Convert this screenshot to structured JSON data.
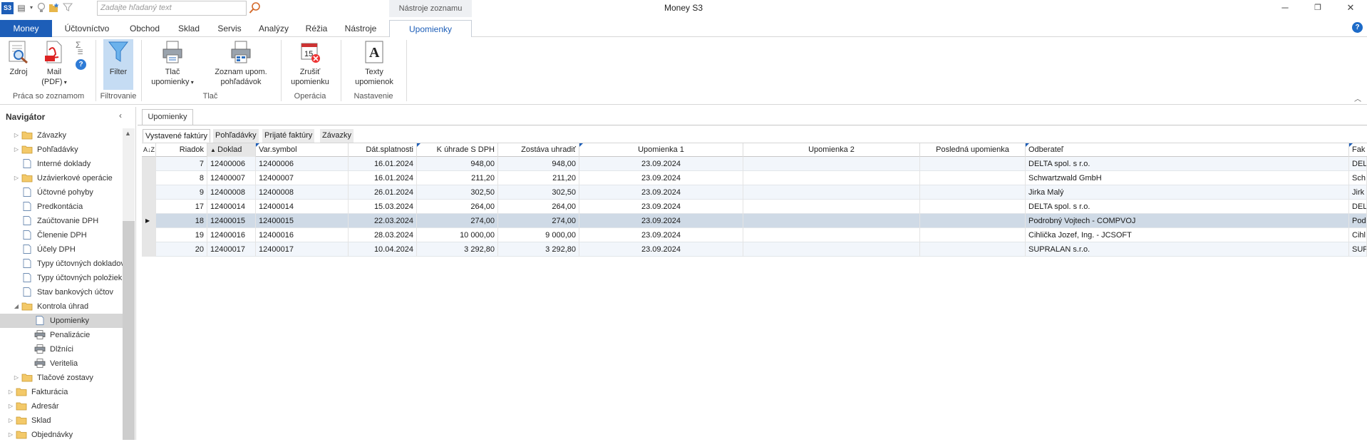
{
  "app": {
    "title": "Money S3",
    "logo": "S3",
    "search_placeholder": "Zadajte hľadaný text",
    "context_tab_title": "Nástroje zoznamu"
  },
  "ribbon_tabs": [
    "Money",
    "Účtovníctvo",
    "Obchod",
    "Sklad",
    "Servis",
    "Analýzy",
    "Réžia",
    "Nástroje",
    "Upomienky"
  ],
  "active_tab": "Upomienky",
  "ribbon": {
    "buttons": {
      "zdroj": "Zdroj",
      "mail_1": "Mail",
      "mail_2": "(PDF)",
      "filter": "Filter",
      "tlac_1": "Tlač",
      "tlac_2": "upomienky",
      "zoznam_1": "Zoznam upom.",
      "zoznam_2": "pohľadávok",
      "zrusit_1": "Zrušiť",
      "zrusit_2": "upomienku",
      "texty_1": "Texty",
      "texty_2": "upomienok",
      "calendar_number": "15"
    },
    "groups": {
      "praca": "Práca so zoznamom",
      "filtrovanie": "Filtrovanie",
      "tlac": "Tlač",
      "operacia": "Operácia",
      "nastavenie": "Nastavenie"
    }
  },
  "navigator": {
    "title": "Navigátor",
    "items": [
      {
        "label": "Závazky",
        "type": "folder",
        "expander": "▷",
        "level": 1
      },
      {
        "label": "Pohľadávky",
        "type": "folder",
        "expander": "▷",
        "level": 1
      },
      {
        "label": "Interné doklady",
        "type": "doc",
        "expander": "",
        "level": 1
      },
      {
        "label": "Uzávierkové operácie",
        "type": "folder",
        "expander": "▷",
        "level": 1
      },
      {
        "label": "Účtovné pohyby",
        "type": "doc",
        "expander": "",
        "level": 1
      },
      {
        "label": "Predkontácia",
        "type": "doc",
        "expander": "",
        "level": 1
      },
      {
        "label": "Zaúčtovanie DPH",
        "type": "doc",
        "expander": "",
        "level": 1
      },
      {
        "label": "Členenie DPH",
        "type": "doc",
        "expander": "",
        "level": 1
      },
      {
        "label": "Účely DPH",
        "type": "doc",
        "expander": "",
        "level": 1
      },
      {
        "label": "Typy účtovných dokladov",
        "type": "doc",
        "expander": "",
        "level": 1
      },
      {
        "label": "Typy účtovných položiek",
        "type": "doc",
        "expander": "",
        "level": 1
      },
      {
        "label": "Stav bankových účtov",
        "type": "doc",
        "expander": "",
        "level": 1
      },
      {
        "label": "Kontrola úhrad",
        "type": "folder",
        "expander": "◢",
        "level": 1
      },
      {
        "label": "Upomienky",
        "type": "doc",
        "expander": "",
        "level": 2,
        "selected": true
      },
      {
        "label": "Penalizácie",
        "type": "print",
        "expander": "",
        "level": 2
      },
      {
        "label": "Dlžníci",
        "type": "print",
        "expander": "",
        "level": 2
      },
      {
        "label": "Veritelia",
        "type": "print",
        "expander": "",
        "level": 2
      },
      {
        "label": "Tlačové zostavy",
        "type": "folder",
        "expander": "▷",
        "level": 1
      },
      {
        "label": "Fakturácia",
        "type": "folder",
        "expander": "▷",
        "level": 0
      },
      {
        "label": "Adresár",
        "type": "folder",
        "expander": "▷",
        "level": 0
      },
      {
        "label": "Sklad",
        "type": "folder",
        "expander": "▷",
        "level": 0
      },
      {
        "label": "Objednávky",
        "type": "folder",
        "expander": "▷",
        "level": 0
      }
    ]
  },
  "document_tab": "Upomienky",
  "subtabs": [
    "Vystavené faktúry",
    "Pohľadávky",
    "Prijaté faktúry",
    "Závazky"
  ],
  "grid": {
    "sort_icon": "A↓Z",
    "columns": [
      "Riadok",
      "Doklad",
      "Var.symbol",
      "Dát.splatnosti",
      "K úhrade S DPH",
      "Zostáva uhradiť",
      "Upomienka 1",
      "Upomienka 2",
      "Posledná upomienka",
      "Odberateľ",
      "Fak"
    ],
    "rows": [
      {
        "riadok": "7",
        "doklad": "12400006",
        "varsymbol": "12400006",
        "splatnost": "16.01.2024",
        "k_uhrade": "948,00",
        "zostava": "948,00",
        "upom1": "23.09.2024",
        "upom2": "",
        "posledna": "",
        "odberatel": "DELTA spol. s r.o.",
        "fak": "DEL"
      },
      {
        "riadok": "8",
        "doklad": "12400007",
        "varsymbol": "12400007",
        "splatnost": "16.01.2024",
        "k_uhrade": "211,20",
        "zostava": "211,20",
        "upom1": "23.09.2024",
        "upom2": "",
        "posledna": "",
        "odberatel": "Schwartzwald GmbH",
        "fak": "Sch"
      },
      {
        "riadok": "9",
        "doklad": "12400008",
        "varsymbol": "12400008",
        "splatnost": "26.01.2024",
        "k_uhrade": "302,50",
        "zostava": "302,50",
        "upom1": "23.09.2024",
        "upom2": "",
        "posledna": "",
        "odberatel": "Jirka Malý",
        "fak": "Jirk"
      },
      {
        "riadok": "17",
        "doklad": "12400014",
        "varsymbol": "12400014",
        "splatnost": "15.03.2024",
        "k_uhrade": "264,00",
        "zostava": "264,00",
        "upom1": "23.09.2024",
        "upom2": "",
        "posledna": "",
        "odberatel": "DELTA spol. s r.o.",
        "fak": "DEL"
      },
      {
        "riadok": "18",
        "doklad": "12400015",
        "varsymbol": "12400015",
        "splatnost": "22.03.2024",
        "k_uhrade": "274,00",
        "zostava": "274,00",
        "upom1": "23.09.2024",
        "upom2": "",
        "posledna": "",
        "odberatel": "Podrobný Vojtech - COMPVOJ",
        "fak": "Pod",
        "current": true
      },
      {
        "riadok": "19",
        "doklad": "12400016",
        "varsymbol": "12400016",
        "splatnost": "28.03.2024",
        "k_uhrade": "10 000,00",
        "zostava": "9 000,00",
        "upom1": "23.09.2024",
        "upom2": "",
        "posledna": "",
        "odberatel": "Cihlička Jozef, Ing. - JCSOFT",
        "fak": "Cihl"
      },
      {
        "riadok": "20",
        "doklad": "12400017",
        "varsymbol": "12400017",
        "splatnost": "10.04.2024",
        "k_uhrade": "3 292,80",
        "zostava": "3 292,80",
        "upom1": "23.09.2024",
        "upom2": "",
        "posledna": "",
        "odberatel": "SUPRALAN s.r.o.",
        "fak": "SUP"
      }
    ],
    "current_row_marker": "▶"
  },
  "colors": {
    "brand_blue": "#1d5eb8",
    "current_row": "#cfdae6",
    "alt_row": "#f2f6fb",
    "filter_selected": "#c5dcf3"
  }
}
